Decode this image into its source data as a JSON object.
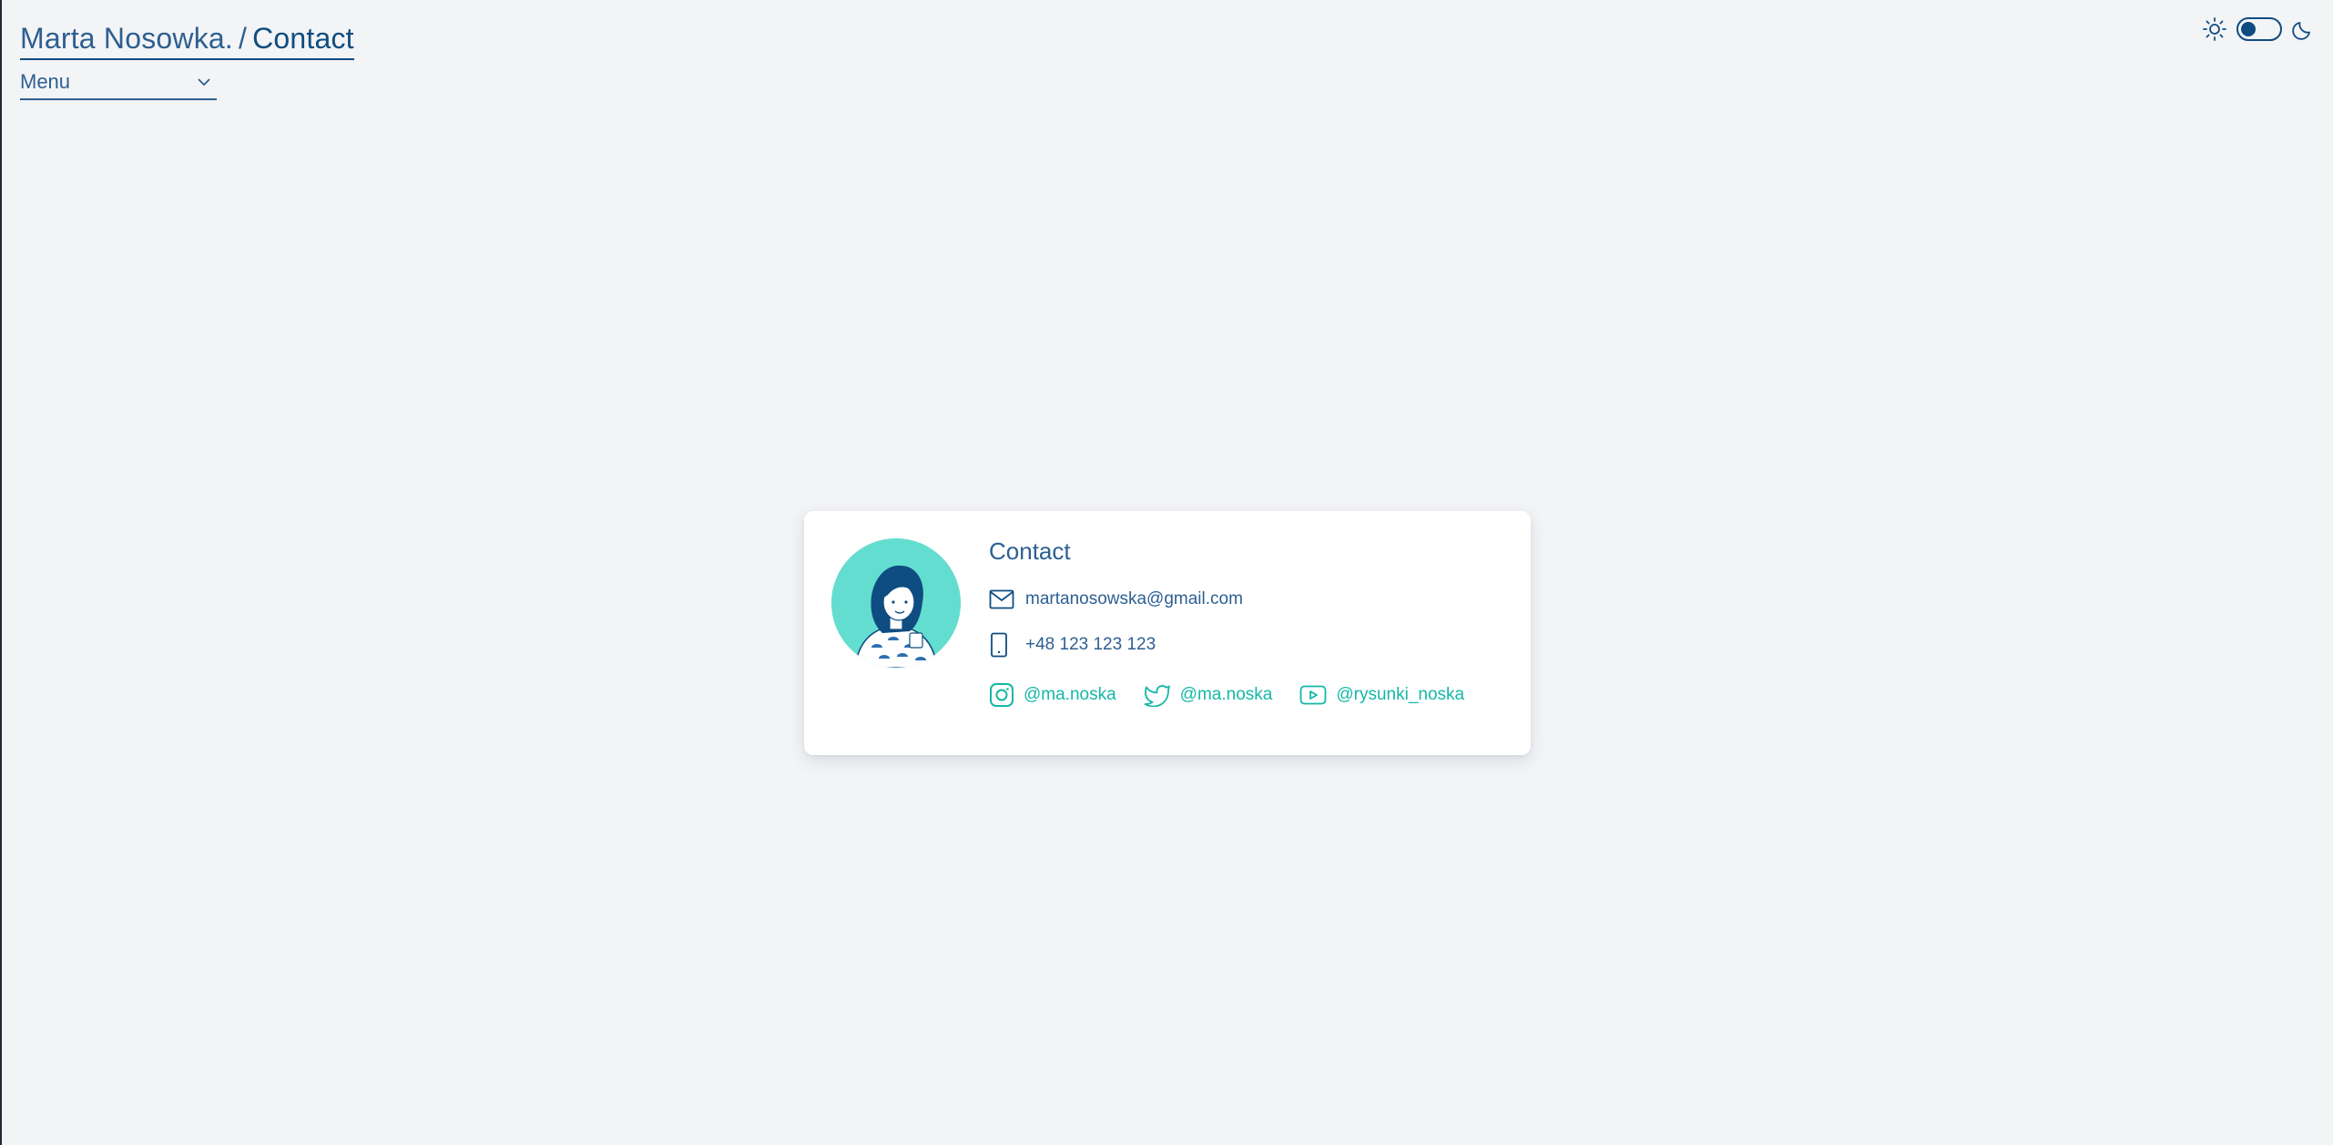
{
  "header": {
    "site_name": "Marta Nosowka.",
    "separator": "/",
    "current_page": "Contact",
    "menu_label": "Menu"
  },
  "theme": {
    "light_icon": "sun-icon",
    "dark_icon": "moon-icon",
    "mode": "light"
  },
  "contact": {
    "title": "Contact",
    "email": "martanosowska@gmail.com",
    "phone": "+48 123 123 123",
    "socials": [
      {
        "icon": "instagram-icon",
        "handle": "@ma.noska"
      },
      {
        "icon": "twitter-icon",
        "handle": "@ma.noska"
      },
      {
        "icon": "youtube-icon",
        "handle": "@rysunki_noska"
      }
    ]
  },
  "colors": {
    "primary": "#0f4c81",
    "accent": "#14b8a6",
    "avatar_bg": "#63ddd0",
    "background": "#f3f4f6"
  }
}
